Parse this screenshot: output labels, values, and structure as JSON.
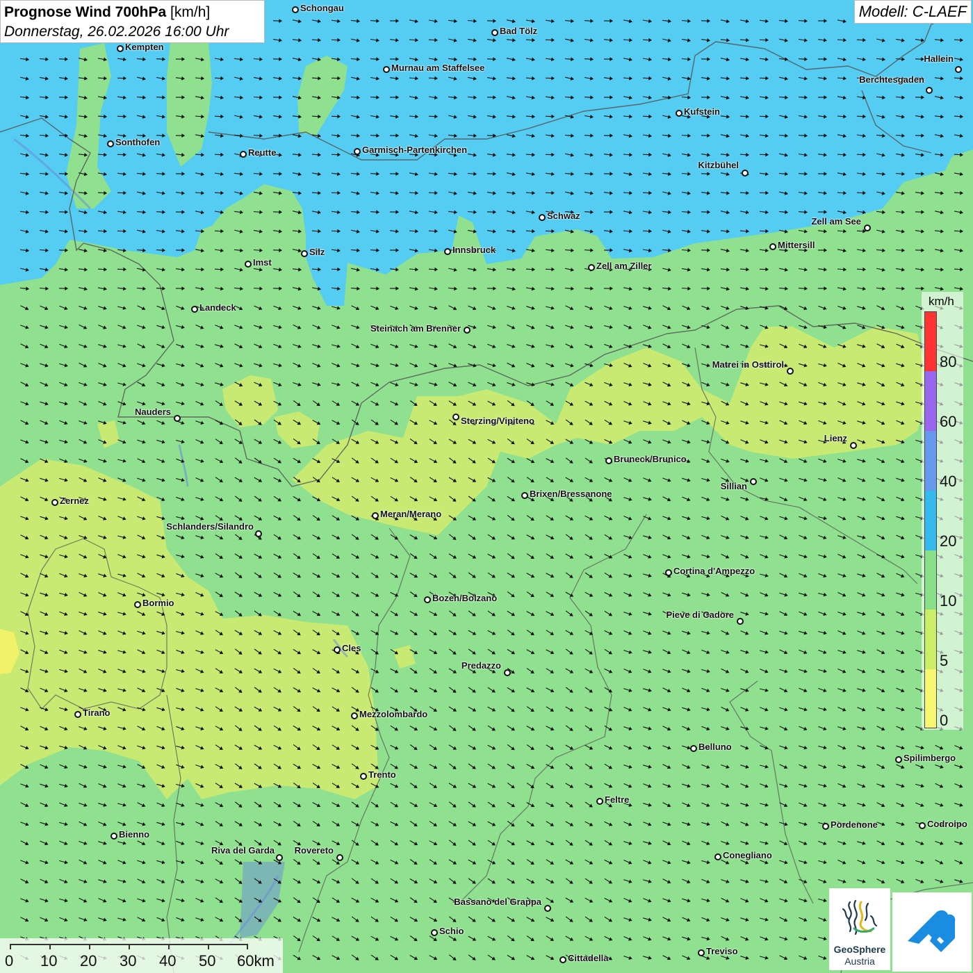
{
  "title": {
    "main_bold": "Prognose Wind 700hPa",
    "main_unit": " [km/h]",
    "date": "Donnerstag, 26.02.2026 16:00 Uhr"
  },
  "model": "Modell: C-LAEF",
  "legend": {
    "unit": "km/h",
    "ticks": [
      "80",
      "60",
      "40",
      "20",
      "10",
      "5",
      "0"
    ],
    "colors": [
      "#ff3333",
      "#9966ee",
      "#6699ee",
      "#33bbee",
      "#88e088",
      "#ccee66",
      "#f8f870"
    ]
  },
  "scale": {
    "labels": [
      "0",
      "10",
      "20",
      "30",
      "40",
      "50",
      "60km"
    ]
  },
  "logo": {
    "name": "GeoSphere",
    "sub": "Austria"
  },
  "cities": [
    {
      "name": "Schongau"
    },
    {
      "name": "Bad Tölz"
    },
    {
      "name": "Kempten"
    },
    {
      "name": "Murnau am Staffelsee"
    },
    {
      "name": "Hallein"
    },
    {
      "name": "Berchtesgaden"
    },
    {
      "name": "Kufstein"
    },
    {
      "name": "Sonthofen"
    },
    {
      "name": "Reutte"
    },
    {
      "name": "Garmisch-Partenkirchen"
    },
    {
      "name": "Kitzbühel"
    },
    {
      "name": "Schwaz"
    },
    {
      "name": "Zell am See"
    },
    {
      "name": "Mittersill"
    },
    {
      "name": "Silz"
    },
    {
      "name": "Innsbruck"
    },
    {
      "name": "Imst"
    },
    {
      "name": "Zell am Ziller"
    },
    {
      "name": "Landeck"
    },
    {
      "name": "Steinach am Brenner"
    },
    {
      "name": "Matrei in Osttirol"
    },
    {
      "name": "Nauders"
    },
    {
      "name": "Sterzing/Vipiteno"
    },
    {
      "name": "Lienz"
    },
    {
      "name": "Bruneck/Brunico"
    },
    {
      "name": "Sillian"
    },
    {
      "name": "Brixen/Bressanone"
    },
    {
      "name": "Zernez"
    },
    {
      "name": "Meran/Merano"
    },
    {
      "name": "Schlanders/Silandro"
    },
    {
      "name": "Cortina d'Ampezzo"
    },
    {
      "name": "Bozen/Bolzano"
    },
    {
      "name": "Bormio"
    },
    {
      "name": "Pieve di Cadore"
    },
    {
      "name": "Cles"
    },
    {
      "name": "Predazzo"
    },
    {
      "name": "Tirano"
    },
    {
      "name": "Mezzolombardo"
    },
    {
      "name": "Belluno"
    },
    {
      "name": "Spilimbergo"
    },
    {
      "name": "Trento"
    },
    {
      "name": "Feltre"
    },
    {
      "name": "Bienno"
    },
    {
      "name": "Pordenone"
    },
    {
      "name": "Codroipo"
    },
    {
      "name": "Riva del Garda"
    },
    {
      "name": "Rovereto"
    },
    {
      "name": "Conegliano"
    },
    {
      "name": "Bassano del Grappa"
    },
    {
      "name": "Schio"
    },
    {
      "name": "Treviso"
    },
    {
      "name": "Cittadella"
    }
  ]
}
